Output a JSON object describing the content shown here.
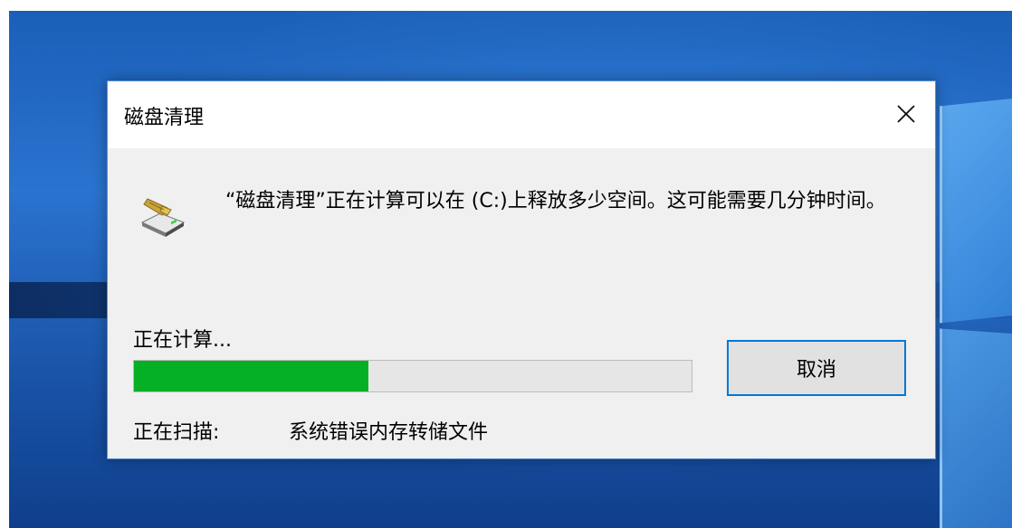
{
  "dialog": {
    "title": "磁盘清理",
    "close_icon": "close-icon",
    "app_icon": "disk-cleanup-icon",
    "message": "“磁盘清理”正在计算可以在 (C:)上释放多少空间。这可能需要几分钟时间。",
    "progress_label": "正在计算...",
    "progress_fraction": 0.42,
    "progress_color": "#06b025",
    "cancel_label": "取消",
    "scan_label": "正在扫描:",
    "scan_item": "系统错误内存转储文件"
  }
}
